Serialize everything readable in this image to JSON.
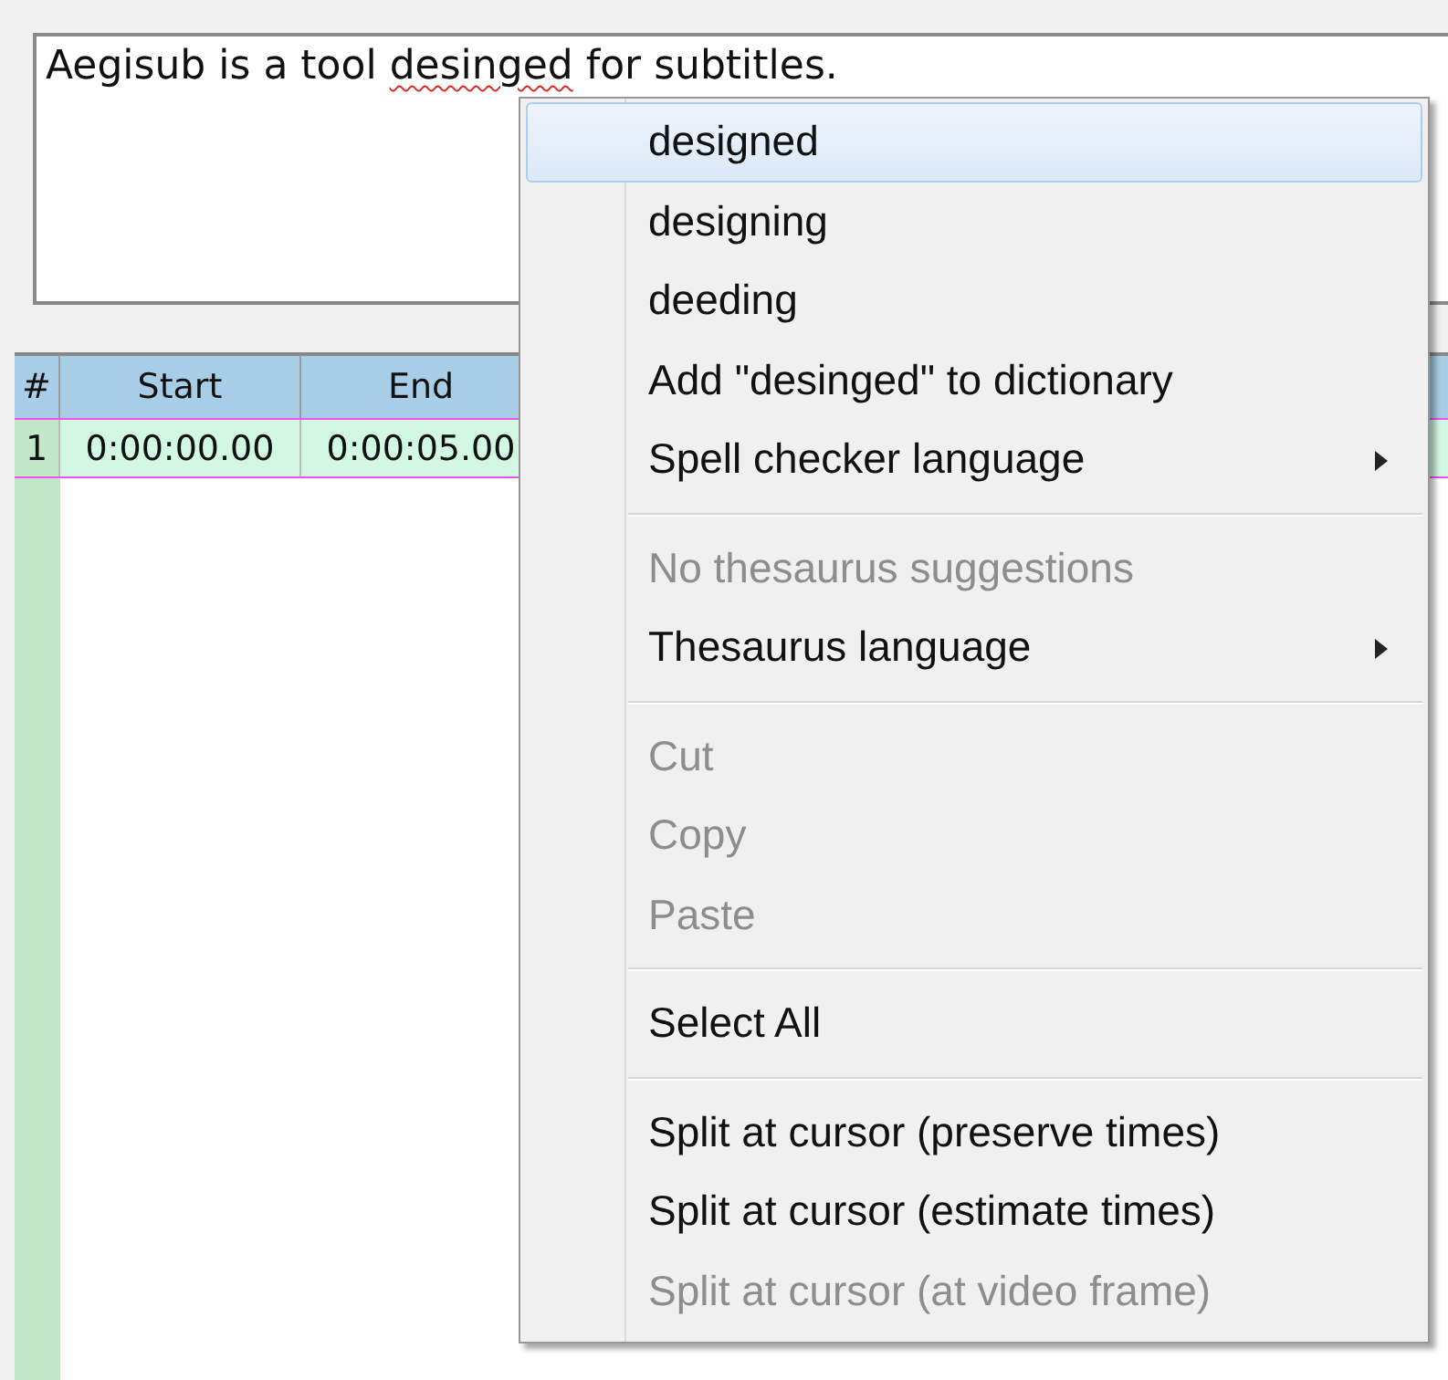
{
  "editor": {
    "segments": [
      {
        "text": "Aegisub is a tool ",
        "misspelled": false
      },
      {
        "text": "desinged",
        "misspelled": true
      },
      {
        "text": " for subtitles.",
        "misspelled": false
      }
    ]
  },
  "grid": {
    "columns": [
      "#",
      "Start",
      "End"
    ],
    "rows": [
      {
        "cells": [
          "1",
          "0:00:00.00",
          "0:00:05.00"
        ]
      }
    ]
  },
  "context_menu": {
    "items": [
      {
        "kind": "item",
        "label": "designed",
        "selected": true,
        "disabled": false,
        "submenu": false
      },
      {
        "kind": "item",
        "label": "designing",
        "selected": false,
        "disabled": false,
        "submenu": false
      },
      {
        "kind": "item",
        "label": "deeding",
        "selected": false,
        "disabled": false,
        "submenu": false
      },
      {
        "kind": "item",
        "label": "Add \"desinged\" to dictionary",
        "selected": false,
        "disabled": false,
        "submenu": false
      },
      {
        "kind": "item",
        "label": "Spell checker language",
        "selected": false,
        "disabled": false,
        "submenu": true
      },
      {
        "kind": "separator"
      },
      {
        "kind": "item",
        "label": "No thesaurus suggestions",
        "selected": false,
        "disabled": true,
        "submenu": false
      },
      {
        "kind": "item",
        "label": "Thesaurus language",
        "selected": false,
        "disabled": false,
        "submenu": true
      },
      {
        "kind": "separator"
      },
      {
        "kind": "item",
        "label": "Cut",
        "selected": false,
        "disabled": true,
        "submenu": false
      },
      {
        "kind": "item",
        "label": "Copy",
        "selected": false,
        "disabled": true,
        "submenu": false
      },
      {
        "kind": "item",
        "label": "Paste",
        "selected": false,
        "disabled": true,
        "submenu": false
      },
      {
        "kind": "separator"
      },
      {
        "kind": "item",
        "label": "Select All",
        "selected": false,
        "disabled": false,
        "submenu": false
      },
      {
        "kind": "separator"
      },
      {
        "kind": "item",
        "label": "Split at cursor (preserve times)",
        "selected": false,
        "disabled": false,
        "submenu": false
      },
      {
        "kind": "item",
        "label": "Split at cursor (estimate times)",
        "selected": false,
        "disabled": false,
        "submenu": false
      },
      {
        "kind": "item",
        "label": "Split at cursor (at video frame)",
        "selected": false,
        "disabled": true,
        "submenu": false
      }
    ]
  }
}
